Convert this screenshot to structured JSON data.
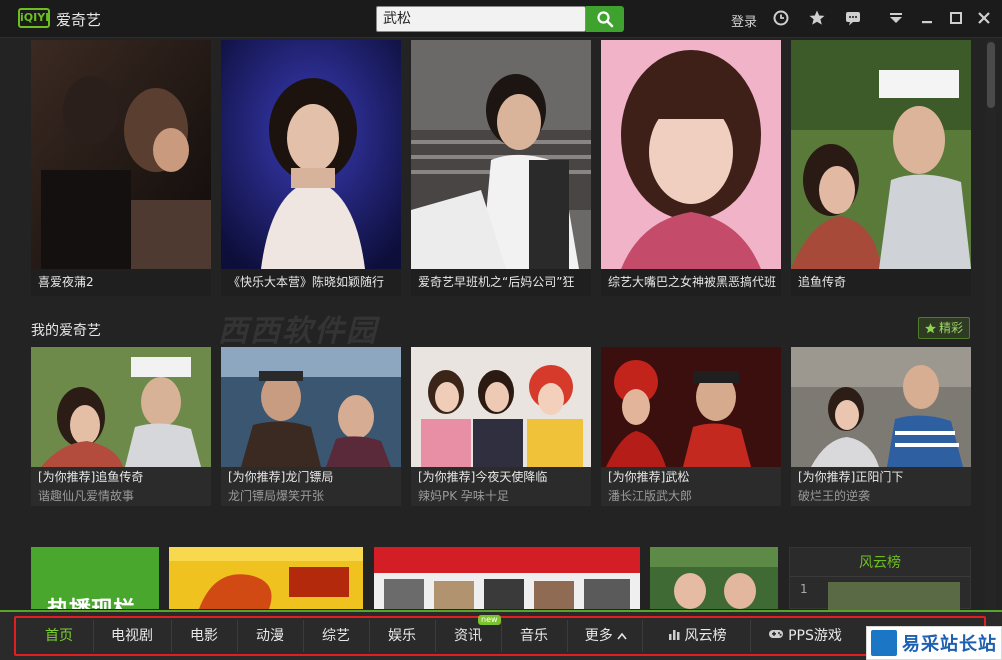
{
  "app": {
    "logo_text": "iQIYI",
    "name": "爱奇艺"
  },
  "search": {
    "value": "武松"
  },
  "header": {
    "login_label": "登录"
  },
  "top_posters": [
    {
      "caption": "喜爱夜蒲2"
    },
    {
      "caption": "《快乐大本营》陈晓如颖随行"
    },
    {
      "caption": "爱奇艺早班机之“后妈公司”狂"
    },
    {
      "caption": "综艺大嘴巴之女神被黑恶搞代班"
    },
    {
      "caption": "追鱼传奇"
    }
  ],
  "my_section": {
    "title": "我的爱奇艺",
    "fav_label": "精彩"
  },
  "recommend_cards": [
    {
      "title": "[为你推荐]追鱼传奇",
      "subtitle": "谐趣仙凡爱情故事"
    },
    {
      "title": "[为你推荐]龙门镖局",
      "subtitle": "龙门镖局爆笑开张"
    },
    {
      "title": "[为你推荐]今夜天使降临",
      "subtitle": "辣妈PK 孕味十足"
    },
    {
      "title": "[为你推荐]武松",
      "subtitle": "潘长江版武大郎"
    },
    {
      "title": "[为你推荐]正阳门下",
      "subtitle": "破烂王的逆袭"
    }
  ],
  "lower": {
    "hot_label": "热播现栏",
    "rank_title": "风云榜",
    "rank_first": "1"
  },
  "watermark": "西西软件园",
  "bottom_nav": {
    "items": [
      "首页",
      "电视剧",
      "电影",
      "动漫",
      "综艺",
      "娱乐",
      "资讯",
      "音乐",
      "更多",
      "风云榜",
      "PPS游戏"
    ],
    "new_badge": "new",
    "active_index": 0
  },
  "corner_logo": "易采站长站",
  "colors": {
    "accent_green": "#6cbf20",
    "highlight_frame": "#e02020"
  }
}
